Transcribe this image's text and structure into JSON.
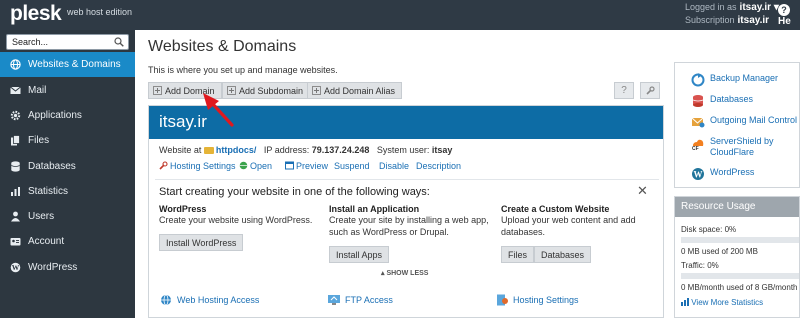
{
  "topbar": {
    "logo": "plesk",
    "logo_sub": "web host edition",
    "logged_in_label": "Logged in as",
    "logged_in_user": "itsay.ir ▾",
    "subscription_label": "Subscription",
    "subscription_value": "itsay.ir",
    "help_label": "He"
  },
  "sidebar": {
    "search_placeholder": "Search...",
    "items": [
      {
        "label": "Websites & Domains",
        "icon": "globe-icon",
        "active": true
      },
      {
        "label": "Mail",
        "icon": "envelope-icon"
      },
      {
        "label": "Applications",
        "icon": "gear-icon"
      },
      {
        "label": "Files",
        "icon": "files-icon"
      },
      {
        "label": "Databases",
        "icon": "database-icon"
      },
      {
        "label": "Statistics",
        "icon": "chart-icon"
      },
      {
        "label": "Users",
        "icon": "user-icon"
      },
      {
        "label": "Account",
        "icon": "id-card-icon"
      },
      {
        "label": "WordPress",
        "icon": "wordpress-icon"
      }
    ]
  },
  "main": {
    "title": "Websites & Domains",
    "description": "This is where you set up and manage websites.",
    "toolbar": {
      "add_domain": "Add Domain",
      "add_subdomain": "Add Subdomain",
      "add_domain_alias": "Add Domain Alias",
      "help_button": "?",
      "settings_icon": "wrench-icon"
    },
    "domain": {
      "name": "itsay.ir",
      "website_at_label": "Website at",
      "website_at_value": "httpdocs/",
      "ip_label": "IP address:",
      "ip_value": "79.137.24.248",
      "sysuser_label": "System user:",
      "sysuser_value": "itsay",
      "actions": [
        "Hosting Settings",
        "Open",
        "Preview",
        "Suspend",
        "Disable",
        "Description"
      ]
    },
    "start": {
      "title": "Start creating your website in one of the following ways:",
      "close": "✕",
      "wordpress": {
        "heading": "WordPress",
        "text": "Create your website using WordPress.",
        "button": "Install WordPress"
      },
      "application": {
        "heading": "Install an Application",
        "text": "Create your site by installing a web app, such as WordPress or Drupal.",
        "button": "Install Apps"
      },
      "custom": {
        "heading": "Create a Custom Website",
        "text": "Upload your web content and add databases.",
        "button_files": "Files",
        "button_databases": "Databases"
      },
      "show_less": "▴ SHOW LESS"
    },
    "bottom_links": [
      "Web Hosting Access",
      "FTP Access",
      "Hosting Settings"
    ]
  },
  "right": {
    "links": [
      {
        "label": "Backup Manager",
        "icon": "backup-icon"
      },
      {
        "label": "Databases",
        "icon": "database-icon"
      },
      {
        "label": "Outgoing Mail Control",
        "icon": "mail-control-icon"
      },
      {
        "label": "ServerShield by CloudFlare",
        "icon": "cloudflare-icon"
      },
      {
        "label": "WordPress",
        "icon": "wordpress-icon"
      }
    ],
    "usage": {
      "title": "Resource Usage",
      "disk_label": "Disk space: 0%",
      "disk_detail": "0 MB used of 200 MB",
      "disk_fraction": 0.0,
      "traffic_label": "Traffic: 0%",
      "traffic_detail": "0 MB/month used of 8 GB/month",
      "traffic_fraction": 0.0,
      "more": "View More Statistics"
    }
  },
  "colors": {
    "accent": "#1a8ac8",
    "domain_header": "#0d6ca5",
    "sidebar": "#2d3740",
    "arrow": "#e0191f"
  }
}
